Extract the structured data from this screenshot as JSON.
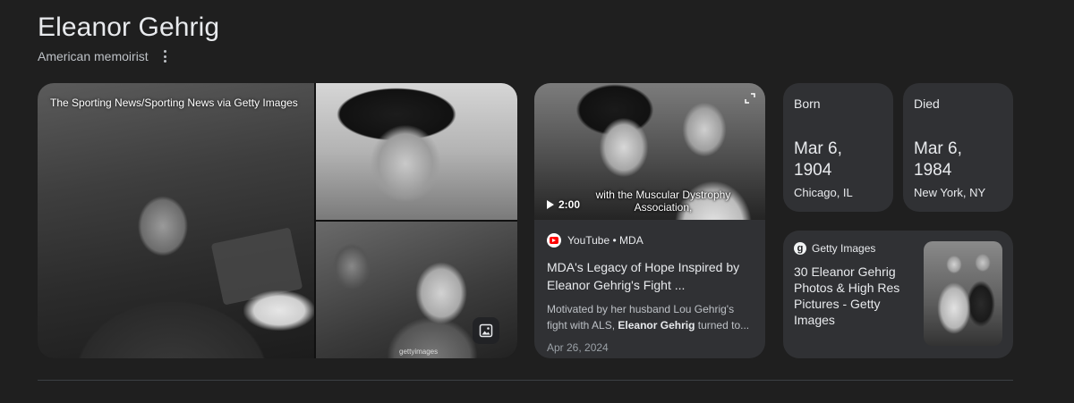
{
  "header": {
    "title": "Eleanor Gehrig",
    "subtitle": "American memoirist"
  },
  "gallery": {
    "credit": "The Sporting News/Sporting News via Getty Images",
    "watermark": "gettyimages"
  },
  "video": {
    "duration": "2:00",
    "caption": "with the Muscular Dystrophy Association,",
    "source": "YouTube • MDA",
    "title": "MDA's Legacy of Hope Inspired by Eleanor Gehrig's Fight ...",
    "snippet_prefix": "Motivated by her husband Lou Gehrig's fight with ALS, ",
    "snippet_bold": "Eleanor Gehrig",
    "snippet_suffix": " turned to...",
    "date": "Apr 26, 2024"
  },
  "facts": {
    "born": {
      "label": "Born",
      "date": "Mar 6, 1904",
      "place": "Chicago, IL"
    },
    "died": {
      "label": "Died",
      "date": "Mar 6, 1984",
      "place": "New York, NY"
    }
  },
  "getty": {
    "source": "Getty Images",
    "title": "30 Eleanor Gehrig Photos & High Res Pictures - Getty Images"
  }
}
